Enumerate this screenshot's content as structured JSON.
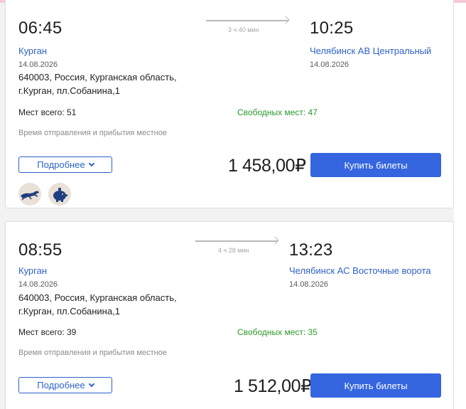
{
  "trips": [
    {
      "departure_time": "06:45",
      "duration": "3 ч 40 мин",
      "arrival_time": "10:25",
      "from_city": "Курган",
      "from_date": "14.08.2026",
      "from_address": "640003, Россия, Курганская область, г.Курган, пл.Собанина,1",
      "to_city": "Челябинск АВ Центральный",
      "to_date": "14.08.2026",
      "seats_total": "Мест всего: 51",
      "seats_free": "Свободных мест: 47",
      "time_note": "Время отправления и прибытия местное",
      "more_label": "Подробнее",
      "price": "1 458,00₽",
      "buy_label": "Купить билеты",
      "badges": [
        "greyhound-icon",
        "piggy-bank-icon"
      ]
    },
    {
      "departure_time": "08:55",
      "duration": "4 ч 28 мин",
      "arrival_time": "13:23",
      "from_city": "Курган",
      "from_date": "14.08.2026",
      "from_address": "640003, Россия, Курганская область, г.Курган, пл.Собанина,1",
      "to_city": "Челябинск АС Восточные ворота",
      "to_date": "14.08.2026",
      "seats_total": "Мест всего: 39",
      "seats_free": "Свободных мест: 35",
      "time_note": "Время отправления и прибытия местное",
      "more_label": "Подробнее",
      "price": "1 512,00₽",
      "buy_label": "Купить билеты"
    }
  ],
  "colors": {
    "accent": "#2d62c6",
    "button": "#3566e0",
    "free_seats": "#2a9a2a",
    "top_bar": "#f4c9d9"
  }
}
